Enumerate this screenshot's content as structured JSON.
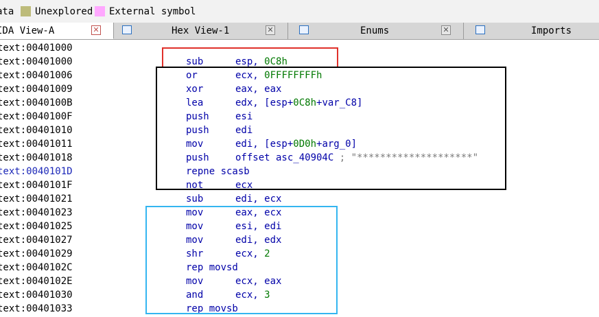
{
  "legend": [
    {
      "label": "ata",
      "color": null
    },
    {
      "label": "Unexplored",
      "color": "#bdbb7a"
    },
    {
      "label": "External symbol",
      "color": "#ffa8ff"
    }
  ],
  "tabs": [
    {
      "label": "IDA View-A",
      "icon": "ida-view-icon",
      "active": true
    },
    {
      "label": "Hex View-1",
      "icon": "hex-view-icon",
      "active": false
    },
    {
      "label": "Enums",
      "icon": "enums-icon",
      "active": false
    },
    {
      "label": "Imports",
      "icon": "imports-icon",
      "active": false
    }
  ],
  "code": [
    {
      "addr": "text:00401000",
      "mnemonic": "",
      "operands": []
    },
    {
      "addr": "text:00401000",
      "mnemonic": "sub",
      "operands": [
        {
          "t": "esp, "
        },
        {
          "t": "0C8h",
          "k": "num"
        }
      ]
    },
    {
      "addr": "text:00401006",
      "mnemonic": "or",
      "operands": [
        {
          "t": "ecx, "
        },
        {
          "t": "0FFFFFFFFh",
          "k": "num"
        }
      ]
    },
    {
      "addr": "text:00401009",
      "mnemonic": "xor",
      "operands": [
        {
          "t": "eax, eax"
        }
      ]
    },
    {
      "addr": "text:0040100B",
      "mnemonic": "lea",
      "operands": [
        {
          "t": "edx, [esp+"
        },
        {
          "t": "0C8h",
          "k": "num"
        },
        {
          "t": "+var_C8]"
        }
      ]
    },
    {
      "addr": "text:0040100F",
      "mnemonic": "push",
      "operands": [
        {
          "t": "esi"
        }
      ]
    },
    {
      "addr": "text:00401010",
      "mnemonic": "push",
      "operands": [
        {
          "t": "edi"
        }
      ]
    },
    {
      "addr": "text:00401011",
      "mnemonic": "mov",
      "operands": [
        {
          "t": "edi, [esp+"
        },
        {
          "t": "0D0h",
          "k": "num"
        },
        {
          "t": "+arg_0]"
        }
      ]
    },
    {
      "addr": "text:00401018",
      "mnemonic": "push",
      "operands": [
        {
          "t": "offset asc_40904C "
        },
        {
          "t": "; \"********************\"",
          "k": "cmt"
        }
      ]
    },
    {
      "addr": "text:0040101D",
      "mnemonic": "repne scasb",
      "operands": [],
      "highlight": true
    },
    {
      "addr": "text:0040101F",
      "mnemonic": "not",
      "operands": [
        {
          "t": "ecx"
        }
      ]
    },
    {
      "addr": "text:00401021",
      "mnemonic": "sub",
      "operands": [
        {
          "t": "edi, ecx"
        }
      ]
    },
    {
      "addr": "text:00401023",
      "mnemonic": "mov",
      "operands": [
        {
          "t": "eax, ecx"
        }
      ]
    },
    {
      "addr": "text:00401025",
      "mnemonic": "mov",
      "operands": [
        {
          "t": "esi, edi"
        }
      ]
    },
    {
      "addr": "text:00401027",
      "mnemonic": "mov",
      "operands": [
        {
          "t": "edi, edx"
        }
      ]
    },
    {
      "addr": "text:00401029",
      "mnemonic": "shr",
      "operands": [
        {
          "t": "ecx, "
        },
        {
          "t": "2",
          "k": "num"
        }
      ]
    },
    {
      "addr": "text:0040102C",
      "mnemonic": "rep movsd",
      "operands": []
    },
    {
      "addr": "text:0040102E",
      "mnemonic": "mov",
      "operands": [
        {
          "t": "ecx, eax"
        }
      ]
    },
    {
      "addr": "text:00401030",
      "mnemonic": "and",
      "operands": [
        {
          "t": "ecx, "
        },
        {
          "t": "3",
          "k": "num"
        }
      ]
    },
    {
      "addr": "text:00401033",
      "mnemonic": "rep movsb",
      "operands": []
    }
  ],
  "annotation_colors": {
    "red": "#e0302a",
    "black": "#000000",
    "cyan": "#33b5f0"
  },
  "colors": {
    "mnemonic": "#0000a8",
    "number": "#007800",
    "comment": "#7a7a7a",
    "highlight_addr": "#1c28b8"
  }
}
